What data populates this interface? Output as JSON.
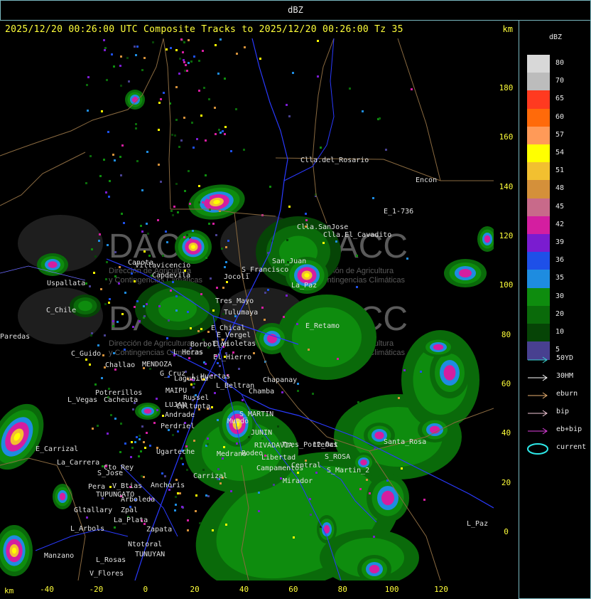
{
  "window": {
    "title": "dBZ"
  },
  "header": {
    "caption": "2025/12/20 00:26:00 UTC Composite Tracks to 2025/12/20 00:26:00 Tz 35",
    "unit": "km"
  },
  "yaxis": {
    "unit": "km",
    "ticks": [
      "180",
      "160",
      "140",
      "120",
      "100",
      "80",
      "60",
      "40",
      "20",
      "0"
    ]
  },
  "xaxis": {
    "unit": "km",
    "ticks": [
      "-40",
      "-20",
      "0",
      "20",
      "40",
      "60",
      "80",
      "100",
      "120"
    ]
  },
  "legend": {
    "title": "dBZ",
    "colors": {
      "80": "#d8d8d8",
      "70": "#bcbcbc",
      "65": "#ff3a20",
      "60": "#ff6a0a",
      "57": "#ff9a58",
      "54": "#ffff00",
      "51": "#f2c030",
      "48": "#d4903a",
      "45": "#c86a8a",
      "42": "#d41ea0",
      "39": "#7a1cd0",
      "36": "#1e50e8",
      "35": "#1e8ce0",
      "30": "#0e8c0e",
      "20": "#0a6a0a",
      "10": "#064406",
      "5": "#484090"
    },
    "levels": [
      "80",
      "70",
      "65",
      "60",
      "57",
      "54",
      "51",
      "48",
      "45",
      "42",
      "39",
      "36",
      "35",
      "30",
      "20",
      "10",
      "5"
    ]
  },
  "tracks": [
    {
      "label": "50YD",
      "color": "#3ad0d0"
    },
    {
      "label": "30HM",
      "color": "#ffffff"
    },
    {
      "label": "eburn",
      "color": "#e8b070"
    },
    {
      "label": "bip",
      "color": "#f2c8d8"
    },
    {
      "label": "eb+bip",
      "color": "#e040e0"
    },
    {
      "label": "current",
      "color": "#2ee8e8"
    }
  ],
  "watermark": {
    "brand": "DACC",
    "line1": "Dirección de Agricultura",
    "line2": "y Contingencias Climáticas"
  },
  "places": [
    "Clla.del_Rosario",
    "Encon",
    "E_1-736",
    "Clla.SanJose",
    "Clla.El_Cavadito",
    "Villavicencio",
    "Uspallata",
    "Canota",
    "Capdevila",
    "Jocoli",
    "S_Francisco",
    "San_Juan",
    "Tres_Mayo",
    "Tulumaya",
    "C_Chile",
    "E_Chical",
    "E_Vergel",
    "E_Retamo",
    "E_Violetas",
    "La_Paz",
    "Borbollon",
    "L_Heras",
    "El_Hierro",
    "C_Guido",
    "Challao",
    "MENDOZA",
    "G_Cruz",
    "Lagunita",
    "L_Huertas",
    "L_Beltran",
    "Chamba",
    "Chapanay",
    "Potrerillos",
    "L_Vegas",
    "Cacheuta",
    "MAIPU",
    "Russel",
    "LUJAN",
    "Cultunta",
    "Andrade",
    "Perdriel",
    "Ugarteche",
    "S_MARTIN",
    "Mundo",
    "JUNIN",
    "RIVADAVIA",
    "Medrano",
    "La_Carrera",
    "S_Jose",
    "Cto_Rey",
    "Pera",
    "TUPUNGATO",
    "Anchoris",
    "Carrizal",
    "Tres_Porteñas",
    "Rodeo",
    "12_Oct",
    "Libertad",
    "Campamentos",
    "Central",
    "Santa_Rosa",
    "S_ROSA",
    "Mirador",
    "V_Btias",
    "Gltallary",
    "Zpal",
    "Arboleda",
    "La_Plata",
    "L_Arbols",
    "Zapata",
    "Manzano",
    "L_Rosas",
    "TUNUYAN",
    "Ntotoral",
    "V_Flores",
    "E_Carrizal",
    "Paredas",
    "L_Paz",
    "S_Martin_2"
  ]
}
